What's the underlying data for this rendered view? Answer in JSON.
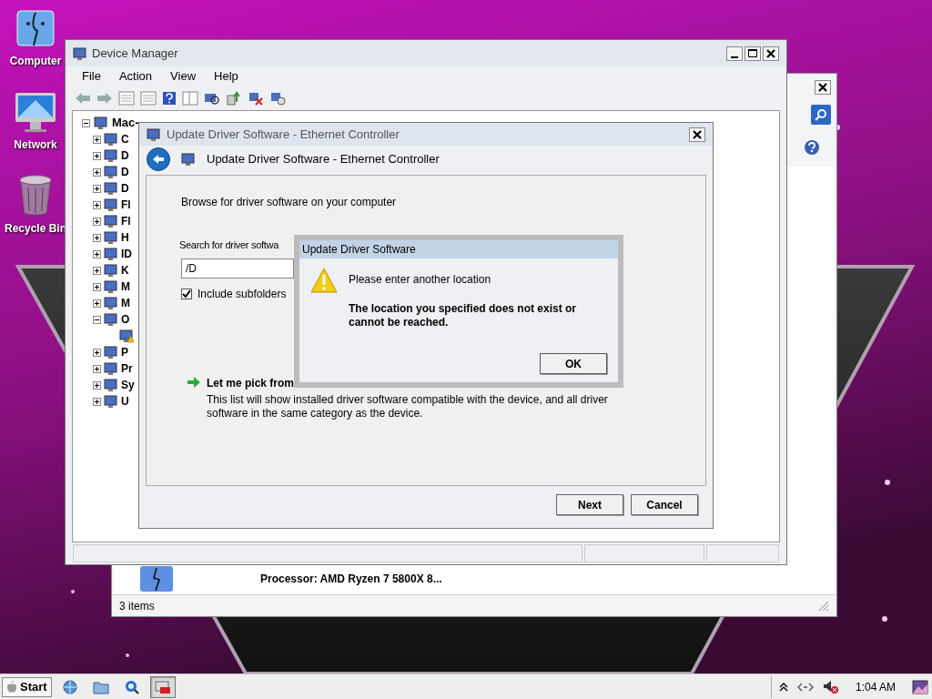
{
  "desktop_icons": [
    {
      "label": "Computer",
      "kind": "computer"
    },
    {
      "label": "Network",
      "kind": "monitor"
    },
    {
      "label": "Recycle Bin",
      "kind": "trash"
    }
  ],
  "back_window": {
    "item": "Processor: AMD Ryzen 7 5800X 8...",
    "status": "3 items"
  },
  "device_manager": {
    "title": "Device Manager",
    "menu": [
      "File",
      "Action",
      "View",
      "Help"
    ],
    "tree": {
      "label": "Mac-",
      "expanded": true,
      "children": [
        {
          "label": "C",
          "expanded": false
        },
        {
          "label": "D",
          "expanded": false
        },
        {
          "label": "D",
          "expanded": false
        },
        {
          "label": "D",
          "expanded": false
        },
        {
          "label": "Fl",
          "expanded": false
        },
        {
          "label": "Fl",
          "expanded": false
        },
        {
          "label": "H",
          "expanded": false
        },
        {
          "label": "ID",
          "expanded": false
        },
        {
          "label": "K",
          "expanded": false
        },
        {
          "label": "M",
          "expanded": false
        },
        {
          "label": "M",
          "expanded": false
        },
        {
          "label": "O",
          "expanded": true,
          "children": [
            {
              "warning": true
            }
          ]
        },
        {
          "label": "P",
          "expanded": false
        },
        {
          "label": "Pr",
          "expanded": false
        },
        {
          "label": "Sy",
          "expanded": false
        },
        {
          "label": "U",
          "expanded": false
        }
      ]
    }
  },
  "wizard": {
    "title": "Update Driver Software - Ethernet Controller",
    "header": "Update Driver Software - Ethernet Controller",
    "heading": "Browse for driver software on your computer",
    "search_label": "Search for driver softwa",
    "path": "/D",
    "include_subfolders": {
      "label": "Include subfolders",
      "checked": true
    },
    "pick": {
      "title": "Let me pick from",
      "description": "This list will show installed driver software compatible with the device, and all driver software in the same category as the device."
    },
    "buttons": [
      "Next",
      "Cancel"
    ]
  },
  "alert": {
    "title": "Update Driver Software",
    "message": "Please enter another location",
    "detail": "The location you specified does not exist or cannot be reached.",
    "button": "OK"
  },
  "taskbar": {
    "start": "Start",
    "quick_launch": [
      {
        "kind": "globe",
        "selected": false
      },
      {
        "kind": "folder",
        "selected": false
      },
      {
        "kind": "search",
        "selected": false
      },
      {
        "kind": "toolbox",
        "selected": true
      }
    ],
    "clock": "1:04 AM"
  }
}
